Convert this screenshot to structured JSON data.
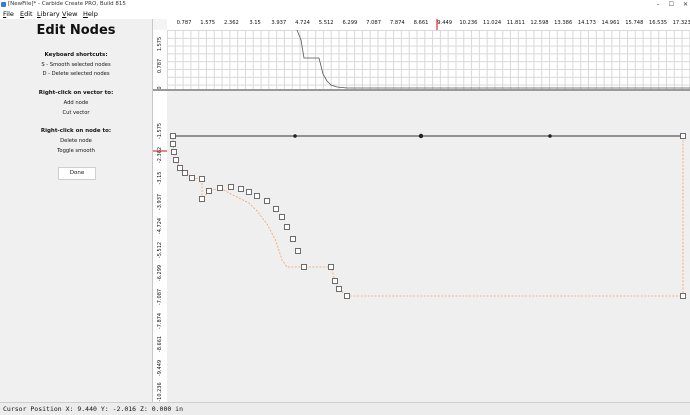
{
  "window": {
    "title": "[NewFile]* - Carbide Create PRO, Build 815",
    "controls": [
      "–",
      "☐",
      "✕"
    ]
  },
  "menu": [
    "File",
    "Edit",
    "Library",
    "View",
    "Help"
  ],
  "panel": {
    "title": "Edit Nodes",
    "keyboard_heading": "Keyboard shortcuts:",
    "keyboard_items": [
      "S - Smooth selected nodes",
      "D - Delete selected nodes"
    ],
    "vector_heading": "Right-click on vector to:",
    "vector_items": [
      "Add node",
      "Cut vector"
    ],
    "node_heading": "Right-click on node to:",
    "node_items": [
      "Delete node",
      "Toggle smooth"
    ],
    "done_label": "Done"
  },
  "rulers": {
    "x_ticks": [
      "0.787",
      "1.575",
      "2.362",
      "3.15",
      "3.937",
      "4.724",
      "5.512",
      "6.299",
      "7.087",
      "7.874",
      "8.661",
      "9.449",
      "10.236",
      "11.024",
      "11.811",
      "12.598",
      "13.386",
      "14.173",
      "14.961",
      "15.748",
      "16.535",
      "17.323"
    ],
    "graph_y_ticks": [
      "1.575",
      "0.787",
      "0"
    ],
    "canvas_y_ticks": [
      "-1.575",
      "-2.362",
      "-3.15",
      "-3.937",
      "-4.724",
      "-5.512",
      "-6.299",
      "-7.087",
      "-7.874",
      "-8.661",
      "-9.449",
      "-10.236"
    ]
  },
  "cursor": {
    "x": "9.440",
    "y": "-2.016",
    "z": "0.000",
    "unit": "in"
  },
  "status_text": "Cursor Position X: 9.440 Y: -2.016 Z: 0.000 in",
  "colors": {
    "accent_red": "#e0303a",
    "selection_orange": "#f0a070",
    "panel_bg": "#f0f0f0",
    "grid": "#d8d8d8"
  }
}
